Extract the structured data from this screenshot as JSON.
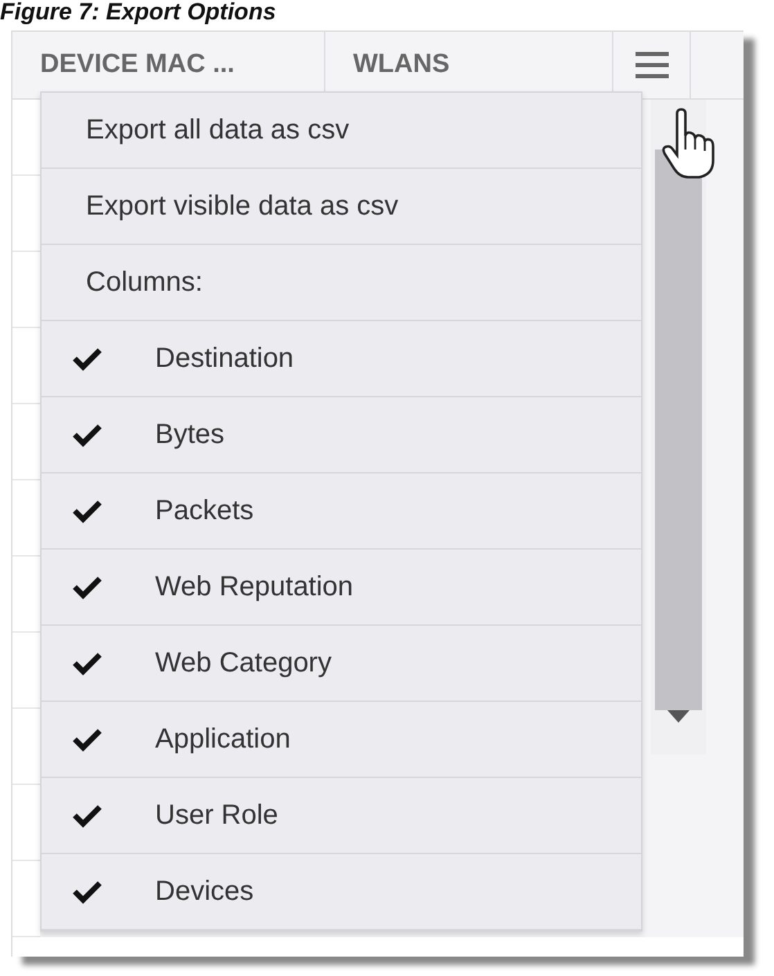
{
  "caption": "Figure 7: Export Options",
  "table": {
    "columns": [
      "DEVICE MAC ...",
      "WLANS"
    ]
  },
  "menu": {
    "items": [
      {
        "kind": "action",
        "label": "Export all data as csv"
      },
      {
        "kind": "action",
        "label": "Export visible data as csv"
      },
      {
        "kind": "heading",
        "label": "Columns:"
      },
      {
        "kind": "column",
        "label": "Destination",
        "checked": true
      },
      {
        "kind": "column",
        "label": "Bytes",
        "checked": true
      },
      {
        "kind": "column",
        "label": "Packets",
        "checked": true
      },
      {
        "kind": "column",
        "label": "Web Reputation",
        "checked": true
      },
      {
        "kind": "column",
        "label": "Web Category",
        "checked": true
      },
      {
        "kind": "column",
        "label": "Application",
        "checked": true
      },
      {
        "kind": "column",
        "label": "User Role",
        "checked": true
      },
      {
        "kind": "column",
        "label": "Devices",
        "checked": true
      }
    ]
  }
}
